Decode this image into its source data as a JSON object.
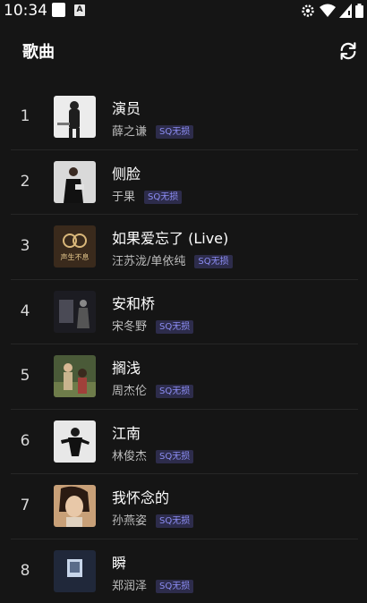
{
  "status": {
    "time": "10:34",
    "notif_a_glyph": "A"
  },
  "header": {
    "title": "歌曲",
    "refresh_icon": "refresh-icon"
  },
  "songs": [
    {
      "rank": "1",
      "title": "演员",
      "artist": "薛之谦",
      "badge": "SQ无损",
      "cover": "#ececec"
    },
    {
      "rank": "2",
      "title": "侧脸",
      "artist": "于果",
      "badge": "SQ无损",
      "cover": "#d9d9d9"
    },
    {
      "rank": "3",
      "title": "如果爱忘了 (Live)",
      "artist": "汪苏泷/单依纯",
      "badge": "SQ无损",
      "cover": "#3a2a1c",
      "cover_text": "声生不息"
    },
    {
      "rank": "4",
      "title": "安和桥",
      "artist": "宋冬野",
      "badge": "SQ无损",
      "cover": "#1c1c22"
    },
    {
      "rank": "5",
      "title": "搁浅",
      "artist": "周杰伦",
      "badge": "SQ无损",
      "cover": "#4a5a38"
    },
    {
      "rank": "6",
      "title": "江南",
      "artist": "林俊杰",
      "badge": "SQ无损",
      "cover": "#e8e8e8"
    },
    {
      "rank": "7",
      "title": "我怀念的",
      "artist": "孙燕姿",
      "badge": "SQ无损",
      "cover": "#c8a078"
    },
    {
      "rank": "8",
      "title": "瞬",
      "artist": "郑润泽",
      "badge": "SQ无损",
      "cover": "#20283a"
    }
  ]
}
